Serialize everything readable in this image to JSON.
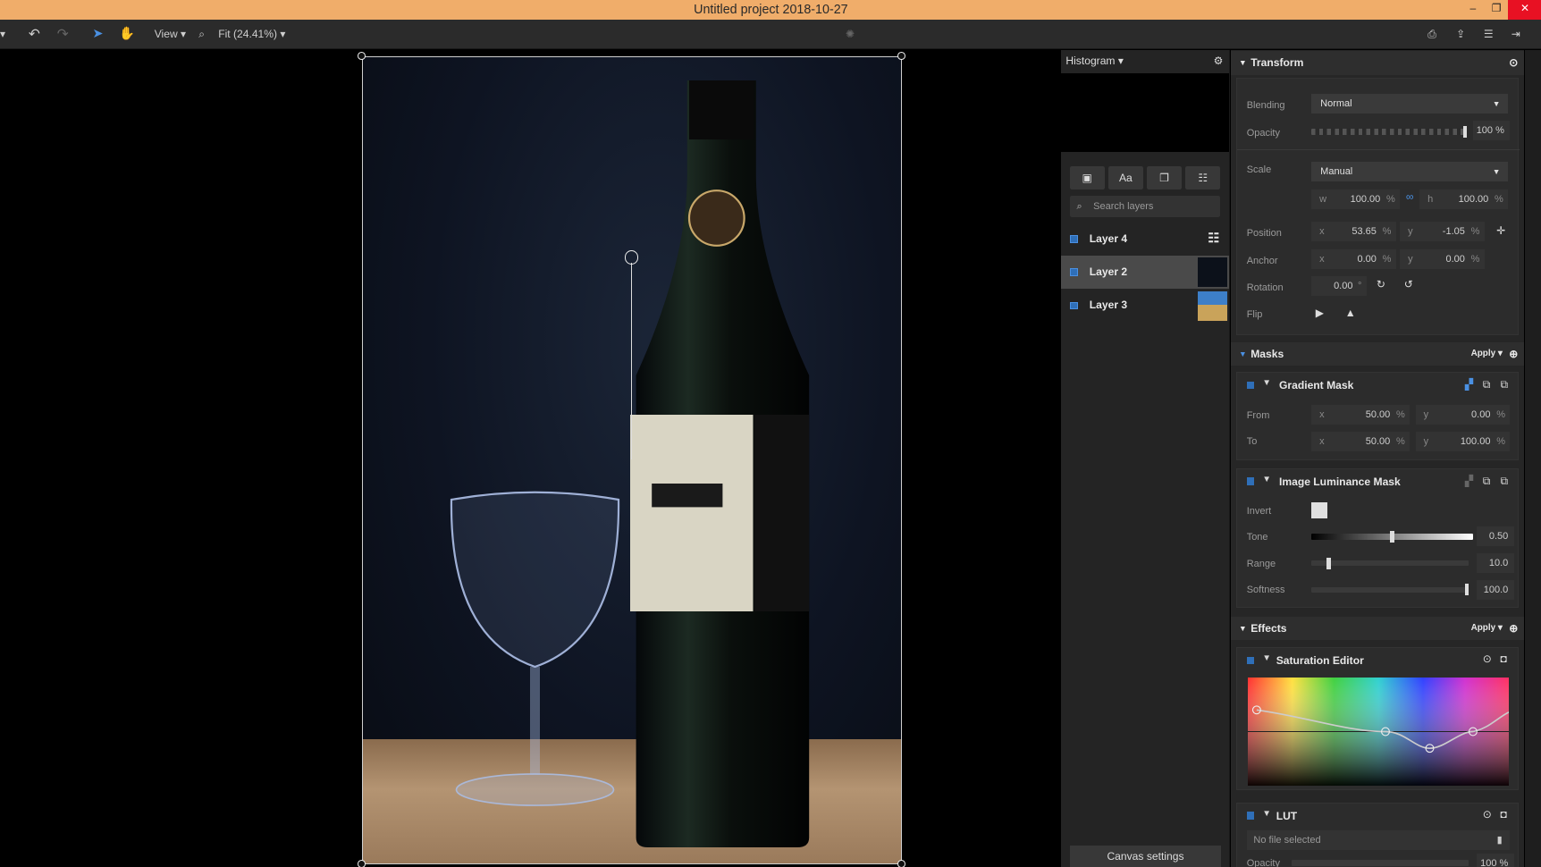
{
  "window": {
    "title": "Untitled project 2018-10-27",
    "controls": [
      "–",
      "❐",
      "✕"
    ]
  },
  "toolbar": {
    "view_label": "View",
    "zoom_label": "Fit (24.41%)"
  },
  "left_panel": {
    "histogram_label": "Histogram",
    "search_placeholder": "Search layers",
    "tab_text_label": "Aa",
    "layers": [
      {
        "label": "Layer 4"
      },
      {
        "label": "Layer 2",
        "selected": true
      },
      {
        "label": "Layer 3"
      }
    ],
    "canvas_settings": "Canvas settings"
  },
  "transform": {
    "title": "Transform",
    "blending_label": "Blending",
    "blending_value": "Normal",
    "opacity_label": "Opacity",
    "opacity_value": "100",
    "opacity_unit": "%",
    "scale_label": "Scale",
    "scale_value": "Manual",
    "w_prefix": "w",
    "w_value": "100.00",
    "h_prefix": "h",
    "h_value": "100.00",
    "position_label": "Position",
    "pos_x": "53.65",
    "pos_y": "-1.05",
    "anchor_label": "Anchor",
    "anchor_x": "0.00",
    "anchor_y": "0.00",
    "rotation_label": "Rotation",
    "rotation_value": "0.00",
    "rotation_unit": "°",
    "flip_label": "Flip",
    "x_prefix": "x",
    "y_prefix": "y",
    "pct": "%"
  },
  "masks": {
    "title": "Masks",
    "apply_label": "Apply",
    "gradient": {
      "title": "Gradient Mask",
      "from_label": "From",
      "from_x": "50.00",
      "from_y": "0.00",
      "to_label": "To",
      "to_x": "50.00",
      "to_y": "100.00"
    },
    "luminance": {
      "title": "Image Luminance Mask",
      "invert_label": "Invert",
      "tone_label": "Tone",
      "tone_value": "0.50",
      "tone_level": 0.5,
      "range_label": "Range",
      "range_value": "10.0",
      "range_level": 0.1,
      "softness_label": "Softness",
      "softness_value": "100.0",
      "softness_level": 1.0
    }
  },
  "effects": {
    "title": "Effects",
    "apply_label": "Apply",
    "saturation": {
      "title": "Saturation Editor"
    },
    "lut": {
      "title": "LUT",
      "file_label": "No file selected",
      "opacity_label": "Opacity",
      "opacity_value": "100 %"
    }
  },
  "accent": "#2f6fb8"
}
